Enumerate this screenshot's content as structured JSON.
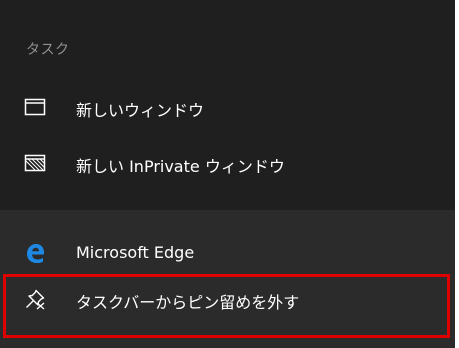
{
  "tasks": {
    "header": "タスク",
    "new_window": {
      "label": "新しいウィンドウ",
      "icon": "window-icon"
    },
    "new_private_window": {
      "label": "新しい InPrivate ウィンドウ",
      "icon": "inprivate-window-icon"
    }
  },
  "pinned": {
    "app": {
      "label": "Microsoft Edge",
      "icon": "edge-icon"
    },
    "unpin": {
      "label": "タスクバーからピン留めを外す",
      "icon": "unpin-icon"
    }
  },
  "colors": {
    "tasks_bg": "#1f1f1f",
    "pinned_bg": "#2b2b2b",
    "text": "#ffffff",
    "header_text": "#8f8f8f",
    "highlight": "#e00000",
    "edge_blue": "#1e88e5"
  }
}
